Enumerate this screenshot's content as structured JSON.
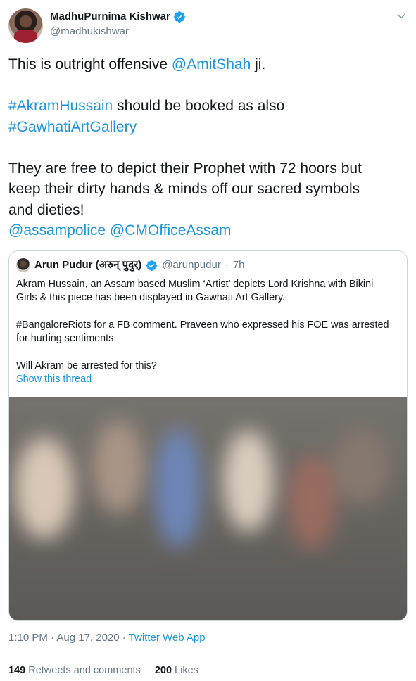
{
  "author": {
    "display_name": "MadhuPurnima Kishwar",
    "handle": "@madhukishwar"
  },
  "tweet": {
    "lines": [
      {
        "parts": [
          {
            "t": "This is outright offensive ",
            "link": false
          },
          {
            "t": "@AmitShah",
            "link": true
          },
          {
            "t": " ji.",
            "link": false
          }
        ]
      },
      {
        "gap": true
      },
      {
        "parts": [
          {
            "t": "#AkramHussain",
            "link": true
          },
          {
            "t": " should be booked as also",
            "link": false
          }
        ]
      },
      {
        "parts": [
          {
            "t": "#GawhatiArtGallery",
            "link": true
          }
        ]
      },
      {
        "gap": true
      },
      {
        "parts": [
          {
            "t": "They are free to depict their Prophet with 72 hoors but",
            "link": false
          }
        ]
      },
      {
        "parts": [
          {
            "t": "keep their dirty hands & minds off our sacred symbols",
            "link": false
          }
        ]
      },
      {
        "parts": [
          {
            "t": "and dieties!",
            "link": false
          }
        ]
      },
      {
        "parts": [
          {
            "t": "@assampolice",
            "link": true
          },
          {
            "t": " ",
            "link": false
          },
          {
            "t": "@CMOfficeAssam",
            "link": true
          }
        ]
      }
    ]
  },
  "quoted": {
    "display_name": "Arun Pudur (अरुन् पुदुर्)",
    "handle": "@arunpudur",
    "separator": "·",
    "time": "7h",
    "lines": [
      "Akram Hussain, an Assam based Muslim ‘Artist’ depicts Lord Krishna with Bikini",
      "Girls & this piece has been displayed in Gawhati Art Gallery.",
      "",
      "#BangaloreRiots for a FB comment. Praveen who expressed his FOE was arrested",
      "for hurting sentiments",
      "",
      "Will Akram be arrested for this?"
    ],
    "show_thread": "Show this thread"
  },
  "meta": {
    "timestamp": "1:10 PM · Aug 17, 2020 · ",
    "source": "Twitter Web App"
  },
  "stats": {
    "retweets_count": "149",
    "retweets_label": "Retweets and comments",
    "likes_count": "200",
    "likes_label": "Likes"
  },
  "colors": {
    "link": "#1b95e0",
    "verified": "#1da1f2",
    "secondary_text": "#657786"
  }
}
